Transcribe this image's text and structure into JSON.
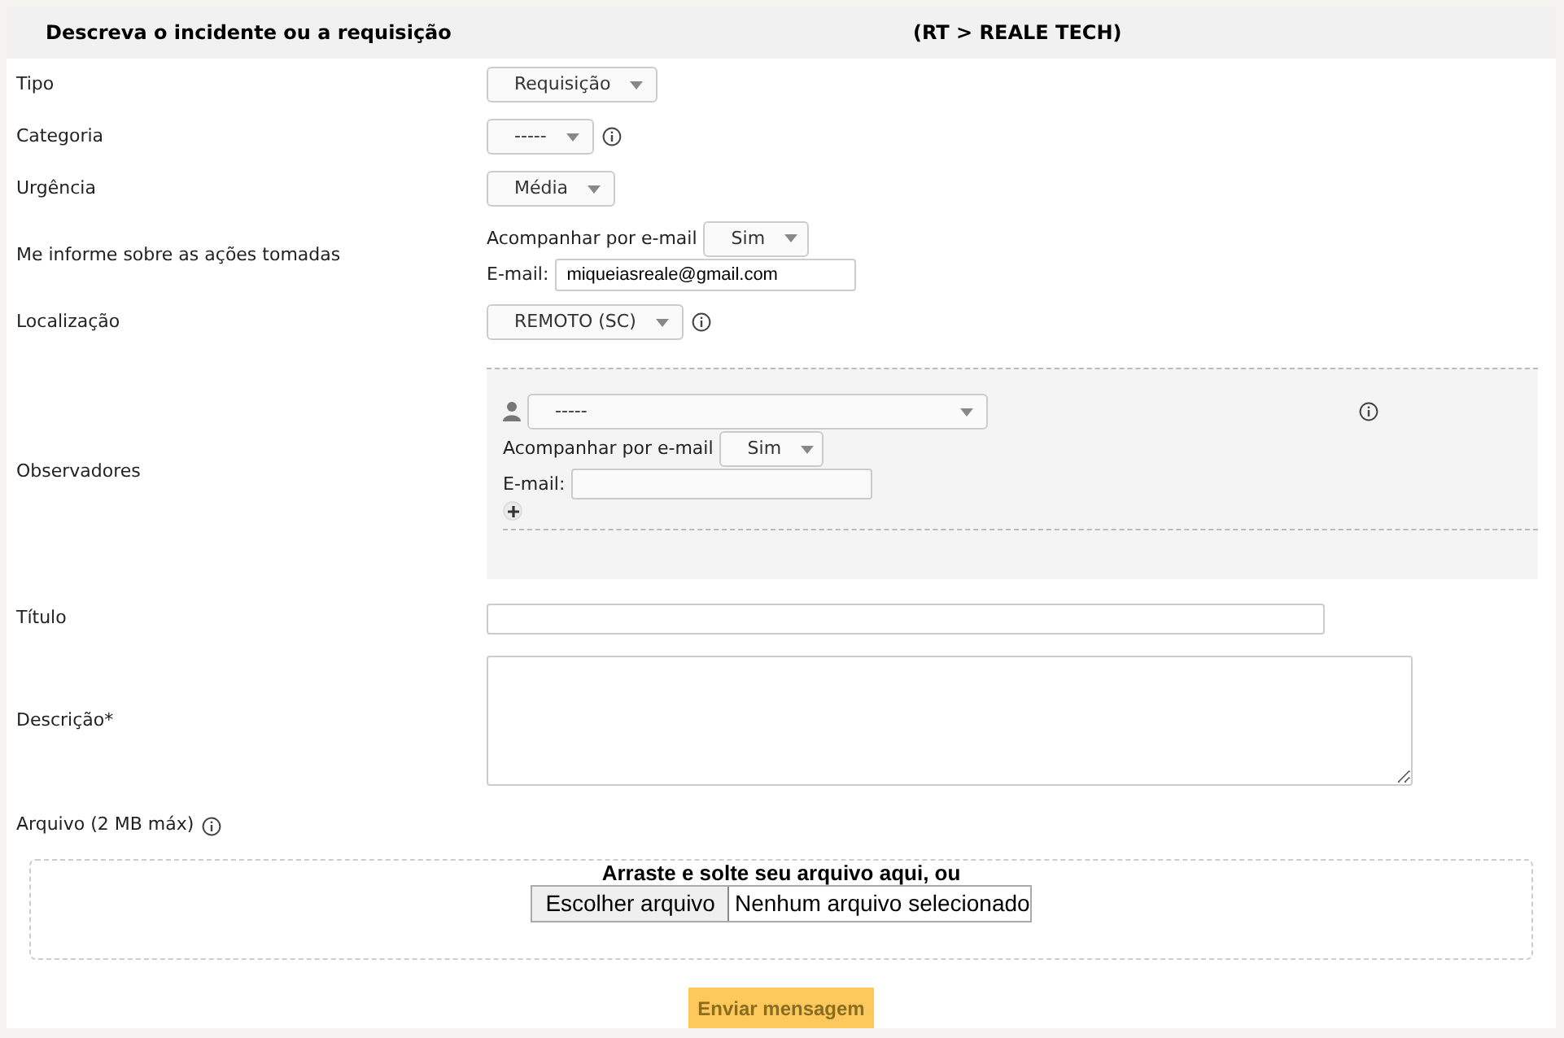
{
  "header": {
    "title": "Descreva o incidente ou a requisição",
    "entity": "(RT > REALE TECH)"
  },
  "fields": [
    {
      "kind": "select",
      "label": "Tipo",
      "value": "Requisição",
      "info": false
    },
    {
      "kind": "select",
      "label": "Categoria",
      "value": "-----",
      "info": true
    },
    {
      "kind": "select",
      "label": "Urgência",
      "value": "Média",
      "info": false
    },
    {
      "kind": "notify",
      "label": "Me informe sobre as ações tomadas",
      "follow_label": "Acompanhar por e-mail",
      "follow_value": "Sim",
      "email_label": "E-mail:",
      "email_value": "miqueiasreale@gmail.com"
    },
    {
      "kind": "select",
      "label": "Localização",
      "value": "REMOTO (SC)",
      "info": true
    },
    {
      "kind": "observers",
      "label": "Observadores",
      "value": "-----",
      "info": true,
      "follow_label": "Acompanhar por e-mail",
      "follow_value": "Sim",
      "email_label": "E-mail:"
    },
    {
      "kind": "text",
      "label": "Título"
    },
    {
      "kind": "textarea",
      "label": "Descrição*"
    }
  ],
  "attachment": {
    "label": "Arquivo (2 MB máx)",
    "info": true,
    "drop_text": "Arraste e solte seu arquivo aqui, ou",
    "choose_button": "Escolher arquivo",
    "no_file": "Nenhum arquivo selecionado"
  },
  "submit": "Enviar mensagem"
}
